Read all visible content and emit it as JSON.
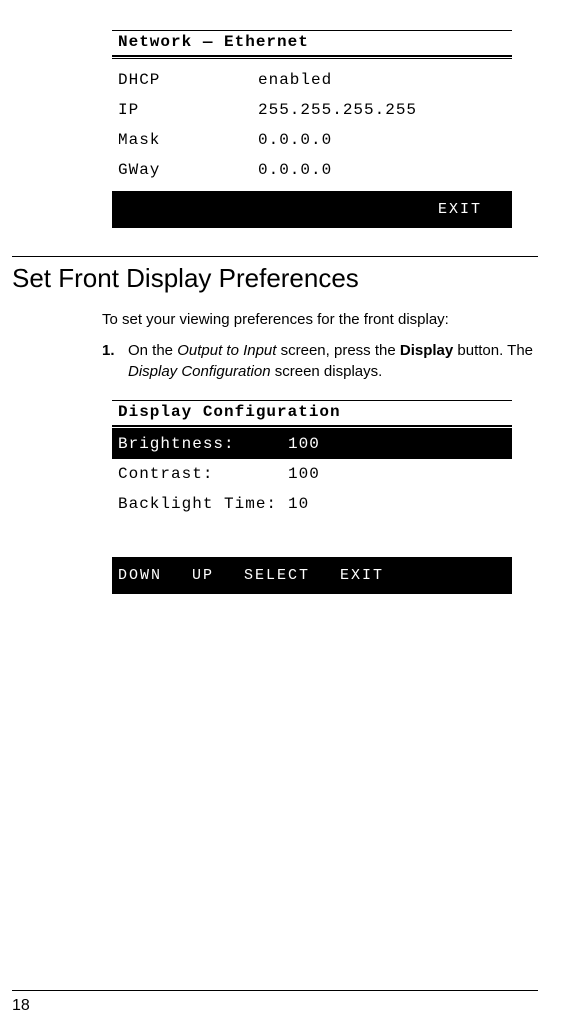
{
  "network_screen": {
    "title": "Network — Ethernet",
    "rows": [
      {
        "label": "DHCP",
        "value": "enabled"
      },
      {
        "label": "IP",
        "value": "255.255.255.255"
      },
      {
        "label": "Mask",
        "value": "0.0.0.0"
      },
      {
        "label": "GWay",
        "value": "0.0.0.0"
      }
    ],
    "footer": {
      "exit": "EXIT"
    }
  },
  "section": {
    "heading": "Set Front Display Preferences",
    "intro": "To set your viewing preferences for the front display:",
    "step_num": "1.",
    "step_prefix": "On the ",
    "step_italic1": "Output to Input",
    "step_mid1": " screen, press the ",
    "step_bold": "Display",
    "step_mid2": " button. The ",
    "step_italic2": "Display Configuration",
    "step_suffix": " screen displays."
  },
  "display_screen": {
    "title": "Display Configuration",
    "rows": [
      {
        "label": "Brightness:",
        "value": "100"
      },
      {
        "label": "Contrast:",
        "value": "100"
      },
      {
        "label": "Backlight Time:",
        "value": "10"
      }
    ],
    "footer": {
      "down": "DOWN",
      "up": "UP",
      "select": "SELECT",
      "exit": "EXIT"
    }
  },
  "page_number": "18"
}
